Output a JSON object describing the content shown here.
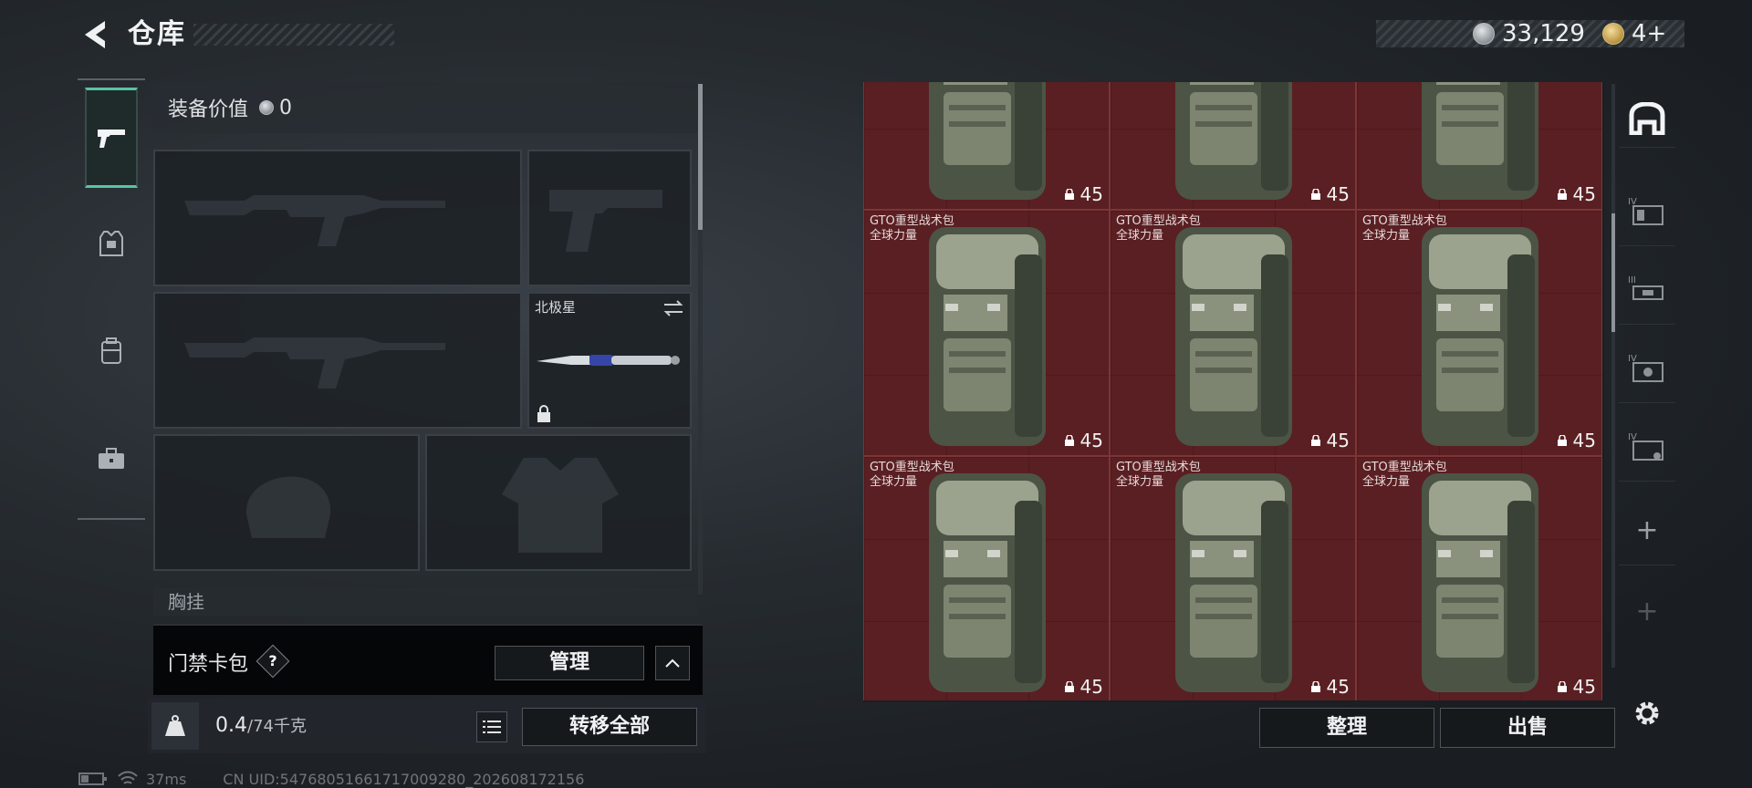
{
  "header": {
    "title": "仓库",
    "silver_amount": "33,129",
    "gold_amount": "4+"
  },
  "left_nav": [
    {
      "name": "weapons",
      "icon": "pistol-icon",
      "active": true
    },
    {
      "name": "armor",
      "icon": "armor-icon",
      "active": false
    },
    {
      "name": "backpack",
      "icon": "backpack-icon",
      "active": false
    },
    {
      "name": "toolkit",
      "icon": "briefcase-icon",
      "active": false
    }
  ],
  "equipment": {
    "value_label": "装备价值",
    "value_amount": "0",
    "melee_slot_label": "北极星",
    "chest_rig_label": "胸挂",
    "keycard_label": "门禁卡包",
    "help_mark": "?",
    "manage_label": "管理",
    "weight_current": "0.4",
    "weight_max": "/74千克",
    "transfer_all_label": "转移全部"
  },
  "status": {
    "ping": "37ms",
    "uid_text": "CN UID:547680516617170092​80_202608172156"
  },
  "storage": {
    "item_name": "GTO重型战术包",
    "item_sub": "全球力量",
    "item_value": "45",
    "rows": [
      {
        "show_name": false,
        "values": [
          "45",
          "45",
          "45"
        ]
      },
      {
        "show_name": true,
        "values": [
          "45",
          "45",
          "45"
        ]
      },
      {
        "show_name": true,
        "values": [
          "45",
          "45",
          "45"
        ]
      }
    ],
    "sort_label": "整理",
    "sell_label": "出售"
  },
  "colors": {
    "accent": "#58c4a2",
    "cell_bg": "#5a1f22",
    "panel_bg": "#1c2126"
  }
}
